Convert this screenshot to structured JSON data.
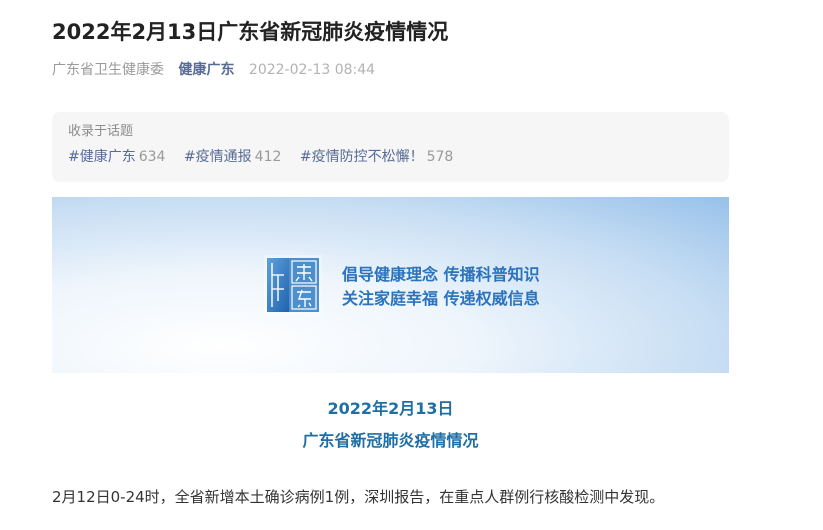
{
  "article": {
    "title": "2022年2月13日广东省新冠肺炎疫情情况",
    "source": "广东省卫生健康委",
    "account": "健康广东",
    "time": "2022-02-13 08:44"
  },
  "topics": {
    "label": "收录于话题",
    "items": [
      {
        "name": "#健康广东",
        "count": "634"
      },
      {
        "name": "#疫情通报",
        "count": "412"
      },
      {
        "name": "#疫情防控不松懈！",
        "count": "578"
      }
    ]
  },
  "banner": {
    "logo_text": "健康广东",
    "slogan_line1": "倡导健康理念 传播科普知识",
    "slogan_line2": "关注家庭幸福 传递权威信息"
  },
  "body": {
    "heading_date": "2022年2月13日",
    "heading_title": "广东省新冠肺炎疫情情况",
    "paragraph1": "2月12日0-24时，全省新增本土确诊病例1例，深圳报告，在重点人群例行核酸检测中发现。"
  },
  "colors": {
    "accent": "#576b95",
    "heading": "#1f6fa5",
    "slogan": "#2b73bd"
  }
}
